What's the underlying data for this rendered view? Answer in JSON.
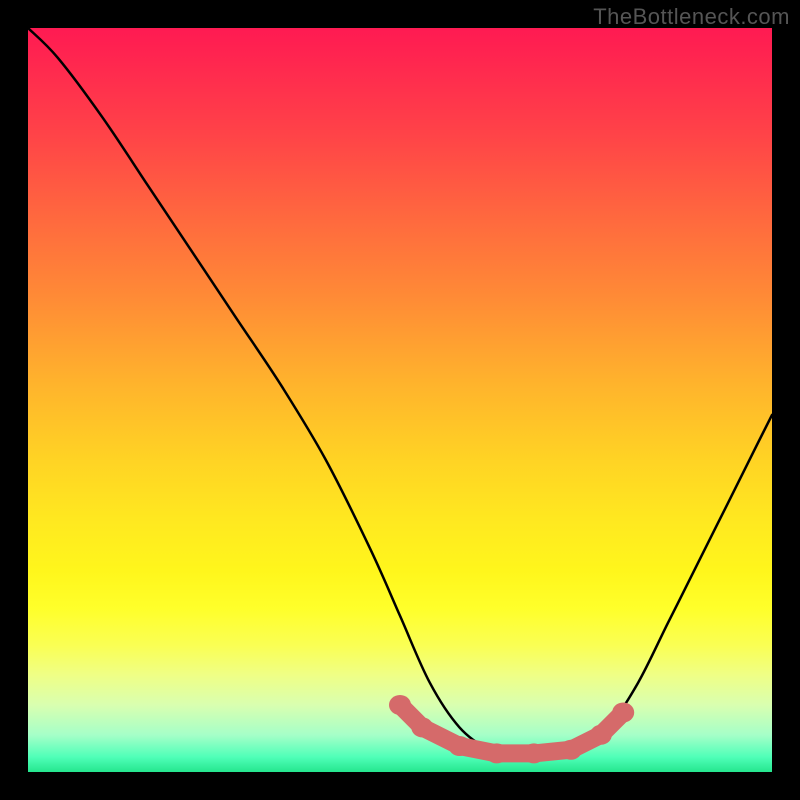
{
  "watermark": {
    "text": "TheBottleneck.com"
  },
  "colors": {
    "curve_line": "#000000",
    "marker_fill": "#d56a6a",
    "marker_stroke": "#c45a5a",
    "background_frame": "#000000"
  },
  "chart_data": {
    "type": "line",
    "title": "",
    "xlabel": "",
    "ylabel": "",
    "xlim": [
      0,
      100
    ],
    "ylim": [
      0,
      100
    ],
    "grid": false,
    "legend": false,
    "series": [
      {
        "name": "bottleneck-curve",
        "x": [
          0,
          4,
          10,
          16,
          22,
          28,
          34,
          40,
          46,
          50,
          54,
          58,
          62,
          66,
          70,
          74,
          78,
          82,
          86,
          90,
          94,
          98,
          100
        ],
        "values": [
          100,
          96,
          88,
          79,
          70,
          61,
          52,
          42,
          30,
          21,
          12,
          6,
          3,
          2,
          2,
          3,
          6,
          12,
          20,
          28,
          36,
          44,
          48
        ]
      }
    ],
    "annotations": {
      "markers": {
        "name": "highlighted-trough",
        "points": [
          {
            "x": 50,
            "y": 9
          },
          {
            "x": 53,
            "y": 6
          },
          {
            "x": 58,
            "y": 3.5
          },
          {
            "x": 63,
            "y": 2.5
          },
          {
            "x": 68,
            "y": 2.5
          },
          {
            "x": 73,
            "y": 3
          },
          {
            "x": 77,
            "y": 5
          },
          {
            "x": 80,
            "y": 8
          }
        ]
      }
    },
    "gradient_description": "vertical red-to-green heat gradient (high=red, low=green)"
  }
}
